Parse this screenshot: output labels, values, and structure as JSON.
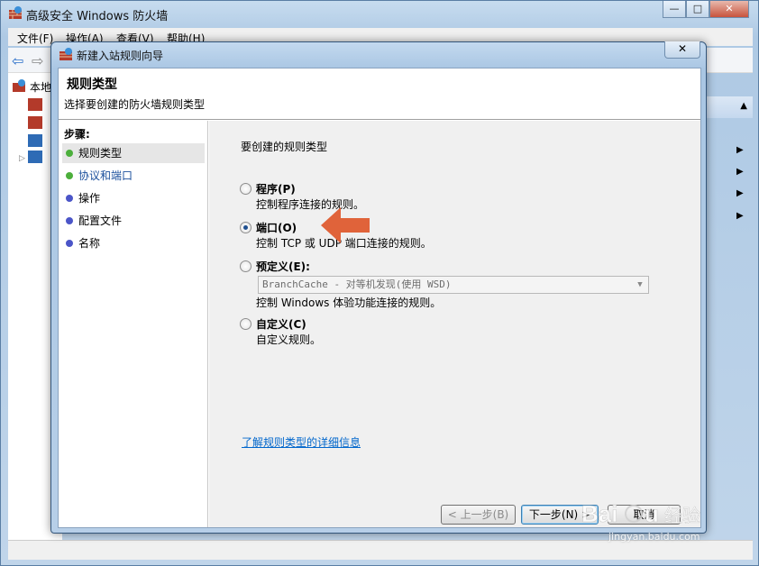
{
  "main_window": {
    "title": "高级安全 Windows 防火墙",
    "controls": {
      "minimize": "—",
      "maximize": "□",
      "close": "✕"
    },
    "menu": [
      "文件(F)",
      "操作(A)",
      "查看(V)",
      "帮助(H)"
    ],
    "tree_root_label": "本地"
  },
  "dialog": {
    "title": "新建入站规则向导",
    "close": "✕",
    "header": {
      "title": "规则类型",
      "subtitle": "选择要创建的防火墙规则类型"
    },
    "steps_title": "步骤:",
    "steps": [
      {
        "label": "规则类型",
        "state": "current",
        "dot_color": "#4caf3c"
      },
      {
        "label": "协议和端口",
        "state": "link",
        "dot_color": "#4caf3c"
      },
      {
        "label": "操作",
        "state": "pending",
        "dot_color": "#4b55c8"
      },
      {
        "label": "配置文件",
        "state": "pending",
        "dot_color": "#4b55c8"
      },
      {
        "label": "名称",
        "state": "pending",
        "dot_color": "#4b55c8"
      }
    ],
    "question": "要创建的规则类型",
    "options": [
      {
        "label": "程序(P)",
        "desc": "控制程序连接的规则。",
        "selected": false
      },
      {
        "label": "端口(O)",
        "desc": "控制 TCP 或 UDP 端口连接的规则。",
        "selected": true
      },
      {
        "label": "预定义(E):",
        "desc": "控制 Windows 体验功能连接的规则。",
        "selected": false
      },
      {
        "label": "自定义(C)",
        "desc": "自定义规则。",
        "selected": false
      }
    ],
    "predefined_selected": "BranchCache - 对等机发现(使用 WSD)",
    "learn_more": "了解规则类型的详细信息",
    "buttons": {
      "back": "< 上一步(B)",
      "next": "下一步(N) >",
      "cancel": "取消"
    }
  },
  "watermark_text": "Baidu 经验",
  "watermark_url": "jingyan.baidu.com",
  "colors": {
    "accent_arrow": "#e0633a",
    "link": "#0066cc"
  }
}
